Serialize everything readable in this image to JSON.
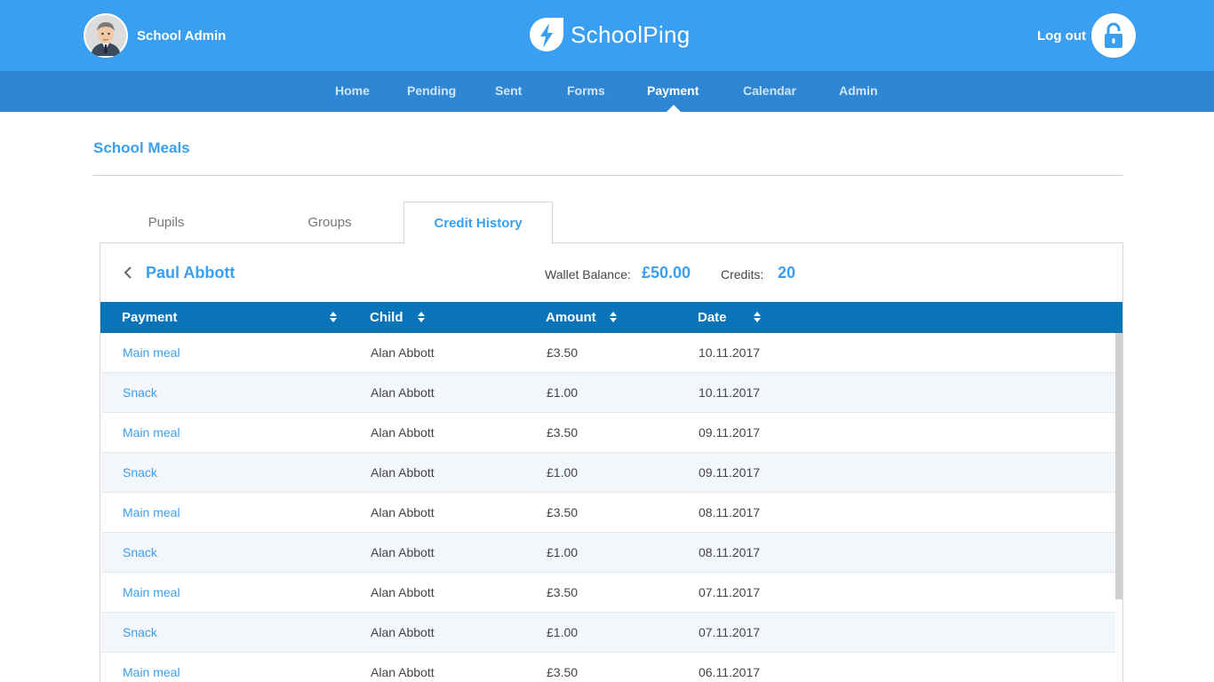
{
  "header": {
    "user_name": "School Admin",
    "brand": "SchoolPing",
    "logout_label": "Log out"
  },
  "nav": {
    "items": [
      {
        "label": "Home"
      },
      {
        "label": "Pending"
      },
      {
        "label": "Sent"
      },
      {
        "label": "Forms"
      },
      {
        "label": "Payment"
      },
      {
        "label": "Calendar"
      },
      {
        "label": "Admin"
      }
    ],
    "active": "Payment"
  },
  "page": {
    "title": "School Meals"
  },
  "tabs": [
    {
      "label": "Pupils"
    },
    {
      "label": "Groups"
    },
    {
      "label": "Credit History"
    }
  ],
  "active_tab": "Credit History",
  "pupil": {
    "name": "Paul Abbott",
    "wallet_label": "Wallet Balance:",
    "wallet_value": "£50.00",
    "credits_label": "Credits:",
    "credits_value": "20"
  },
  "table": {
    "columns": [
      "Payment",
      "Child",
      "Amount",
      "Date"
    ],
    "rows": [
      {
        "payment": "Main meal",
        "child": "Alan Abbott",
        "amount": "£3.50",
        "date": "10.11.2017"
      },
      {
        "payment": "Snack",
        "child": "Alan Abbott",
        "amount": "£1.00",
        "date": "10.11.2017"
      },
      {
        "payment": "Main meal",
        "child": "Alan Abbott",
        "amount": "£3.50",
        "date": "09.11.2017"
      },
      {
        "payment": "Snack",
        "child": "Alan Abbott",
        "amount": "£1.00",
        "date": "09.11.2017"
      },
      {
        "payment": "Main meal",
        "child": "Alan Abbott",
        "amount": "£3.50",
        "date": "08.11.2017"
      },
      {
        "payment": "Snack",
        "child": "Alan Abbott",
        "amount": "£1.00",
        "date": "08.11.2017"
      },
      {
        "payment": "Main meal",
        "child": "Alan Abbott",
        "amount": "£3.50",
        "date": "07.11.2017"
      },
      {
        "payment": "Snack",
        "child": "Alan Abbott",
        "amount": "£1.00",
        "date": "07.11.2017"
      },
      {
        "payment": "Main meal",
        "child": "Alan Abbott",
        "amount": "£3.50",
        "date": "06.11.2017"
      }
    ]
  },
  "icons": {
    "avatar": "user-avatar-icon",
    "brand": "lightning-bolt-icon",
    "logout": "unlocked-padlock-icon",
    "back": "chevron-left-icon",
    "sort": "sort-arrows-icon"
  },
  "colors": {
    "primary": "#3a9ff0",
    "nav_bar": "#2f87d3",
    "table_header": "#0a74b9",
    "row_alt": "#f3f6fa"
  }
}
